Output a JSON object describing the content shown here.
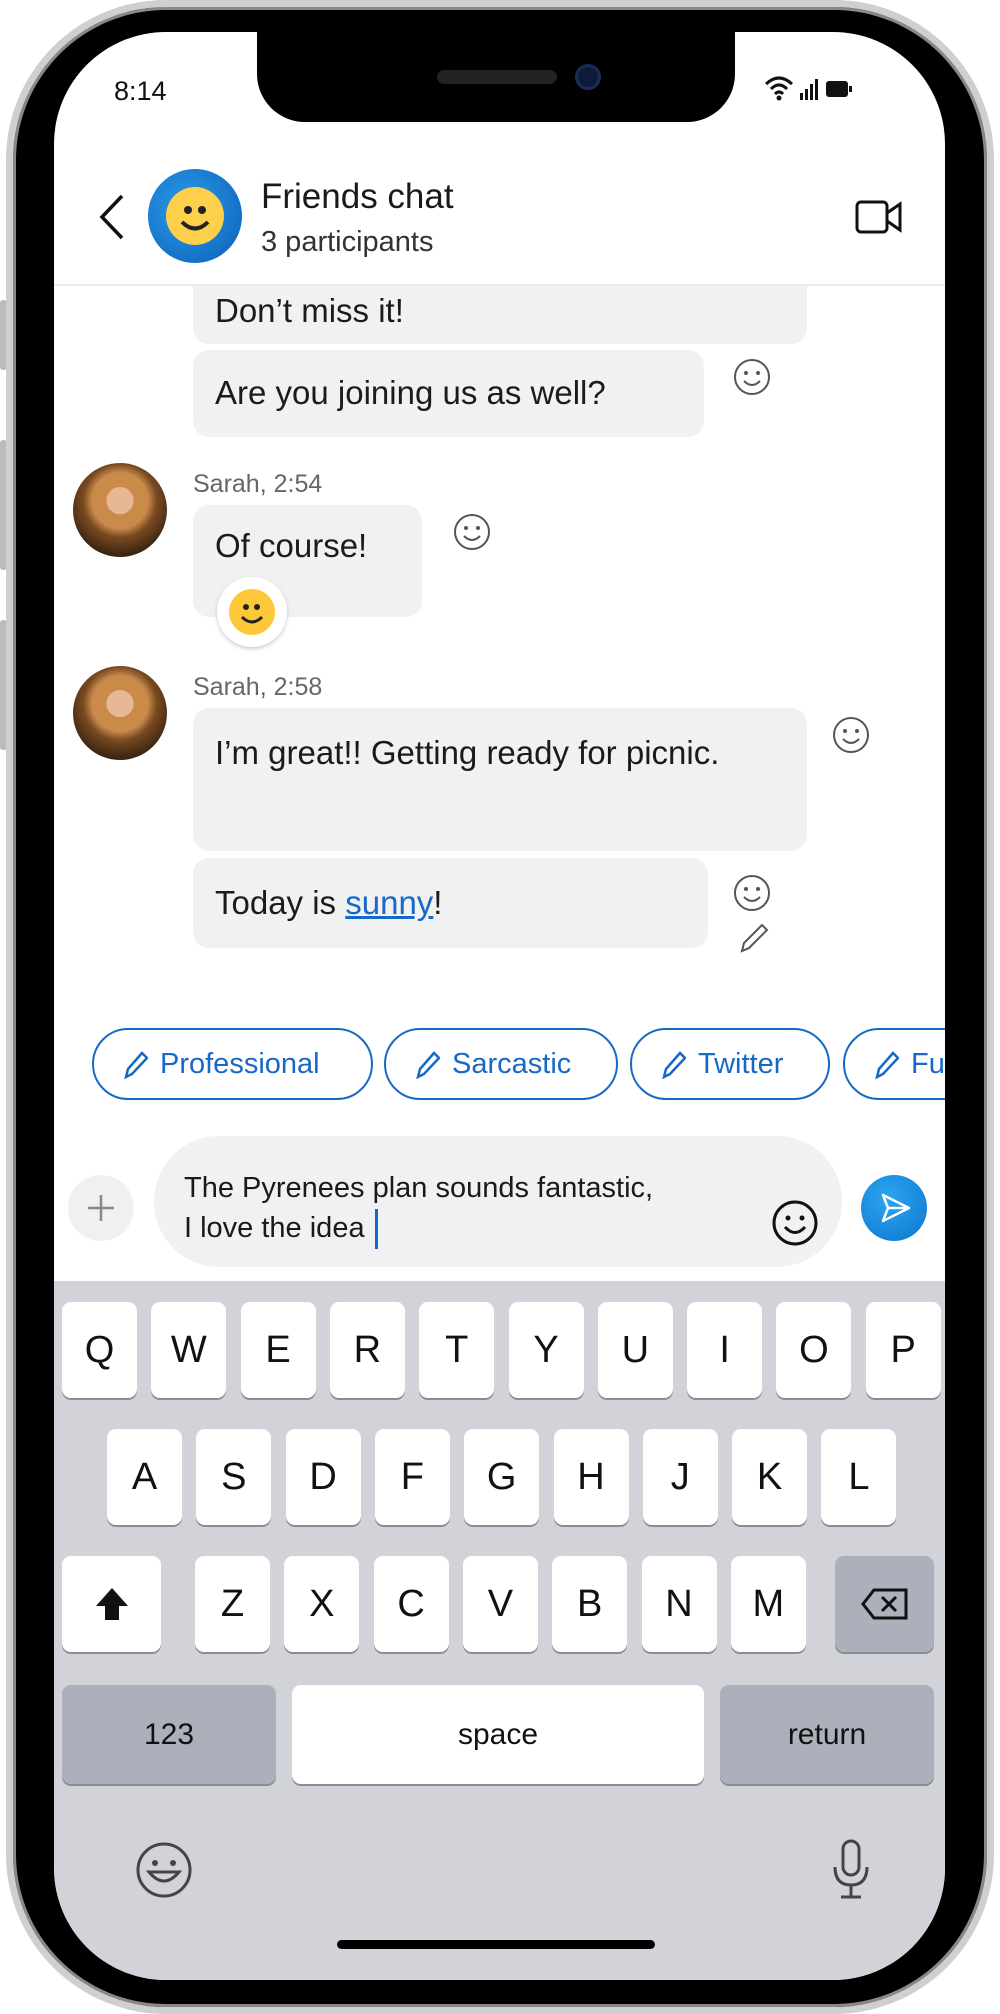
{
  "status_bar": {
    "time": "8:14",
    "icons": [
      "wifi-icon",
      "signal-icon",
      "battery-icon"
    ]
  },
  "header": {
    "title": "Friends chat",
    "subtitle": "3 participants",
    "back_icon": "chevron-left-icon",
    "call_icon": "video-camera-icon"
  },
  "messages": [
    {
      "text": "Don’t miss it!"
    },
    {
      "text": "Are you joining us as well?"
    },
    {
      "sender": "Sarah, 2:54",
      "text": "Of course!",
      "reaction": "smiley-emoji"
    },
    {
      "sender": "Sarah, 2:58",
      "text": "I’m great!! Getting ready for picnic."
    },
    {
      "text_before": "Today is ",
      "link": "sunny",
      "text_after": "!"
    }
  ],
  "tone_chips": [
    {
      "label": "Professional"
    },
    {
      "label": "Sarcastic"
    },
    {
      "label": "Twitter"
    },
    {
      "label": "Fu"
    }
  ],
  "composer": {
    "line1": "The Pyrenees plan sounds fantastic,",
    "line2": "I love the idea"
  },
  "keyboard": {
    "row1": [
      "Q",
      "W",
      "E",
      "R",
      "T",
      "Y",
      "U",
      "I",
      "O",
      "P"
    ],
    "row2": [
      "A",
      "S",
      "D",
      "F",
      "G",
      "H",
      "J",
      "K",
      "L"
    ],
    "row3": [
      "Z",
      "X",
      "C",
      "V",
      "B",
      "N",
      "M"
    ],
    "numbers": "123",
    "space": "space",
    "return": "return"
  },
  "colors": {
    "accent": "#1769c7",
    "bubble": "#f1f1f1",
    "keyboard": "#d1d3d9",
    "send": "#1a8fe0"
  }
}
